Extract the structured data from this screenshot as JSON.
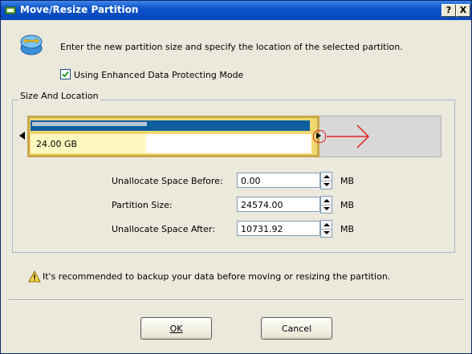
{
  "window": {
    "title": "Move/Resize Partition",
    "help_button": "?",
    "close_button": "X"
  },
  "header": {
    "instruction": "Enter the new partition size and specify the location of the selected partition."
  },
  "options": {
    "enhanced_mode_label": "Using Enhanced Data Protecting Mode",
    "enhanced_mode_checked": true
  },
  "size_location": {
    "group_label": "Size And Location",
    "partition_size_text": "24.00 GB"
  },
  "form": {
    "unallocate_before_label": "Unallocate Space Before:",
    "unallocate_before_value": "0.00",
    "partition_size_label": "Partition Size:",
    "partition_size_value": "24574.00",
    "unallocate_after_label": "Unallocate Space After:",
    "unallocate_after_value": "10731.92",
    "unit": "MB"
  },
  "warning": {
    "text": "It's recommended to backup your data before moving or resizing the partition."
  },
  "buttons": {
    "ok_label": "OK",
    "cancel_label": "Cancel"
  },
  "colors": {
    "title_bar": "#0b52c9",
    "partition_border": "#c9a74b",
    "used_space": "#0d5f9e",
    "annotation_red": "#e02020"
  }
}
